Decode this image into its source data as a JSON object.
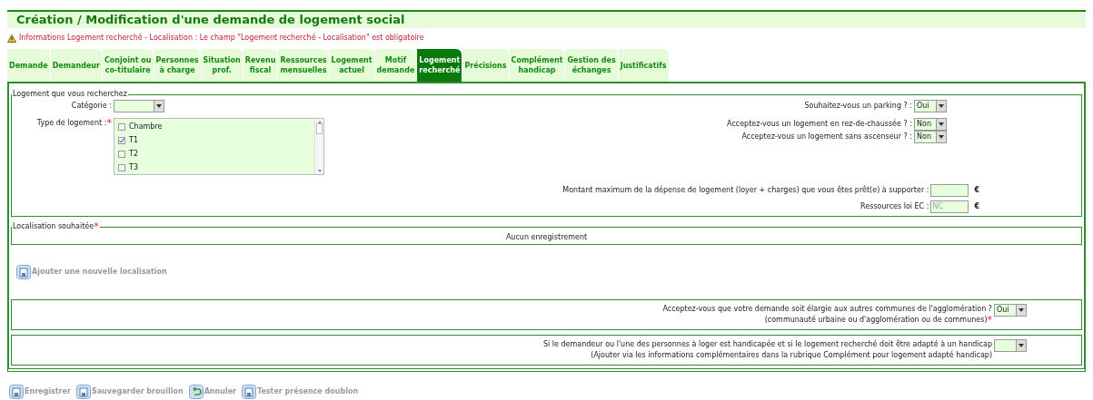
{
  "title": "Création / Modification d'une demande de logement social",
  "warning": "Informations Logement recherché - Localisation : Le champ \"Logement recherché - Localisation\" est obligatoire",
  "tabs": [
    {
      "lines": [
        "Demande"
      ],
      "selected": false
    },
    {
      "lines": [
        "Demandeur"
      ],
      "selected": false
    },
    {
      "lines": [
        "Conjoint ou",
        "co-titulaire"
      ],
      "selected": false
    },
    {
      "lines": [
        "Personnes",
        "à charge"
      ],
      "selected": false
    },
    {
      "lines": [
        "Situation",
        "prof."
      ],
      "selected": false
    },
    {
      "lines": [
        "Revenu",
        "fiscal"
      ],
      "selected": false
    },
    {
      "lines": [
        "Ressources",
        "mensuelles"
      ],
      "selected": false
    },
    {
      "lines": [
        "Logement",
        "actuel"
      ],
      "selected": false
    },
    {
      "lines": [
        "Motif",
        "demande"
      ],
      "selected": false
    },
    {
      "lines": [
        "Logement",
        "recherché"
      ],
      "selected": true
    },
    {
      "lines": [
        "Précisions"
      ],
      "selected": false
    },
    {
      "lines": [
        "Complément",
        "handicap"
      ],
      "selected": false
    },
    {
      "lines": [
        "Gestion des",
        "échanges"
      ],
      "selected": false
    },
    {
      "lines": [
        "Justificatifs"
      ],
      "selected": false
    }
  ],
  "logement": {
    "legend": "Logement que vous recherchez",
    "categorie": {
      "label": "Catégorie :"
    },
    "type": {
      "label": "Type de logement :",
      "required_mark": "*",
      "options": [
        {
          "label": "Chambre",
          "checked": false
        },
        {
          "label": "T1",
          "checked": true
        },
        {
          "label": "T2",
          "checked": false
        },
        {
          "label": "T3",
          "checked": false
        }
      ]
    },
    "questions": [
      {
        "label": "Souhaitez-vous un parking ? :",
        "value": "Oui"
      },
      {
        "label": "Acceptez-vous un logement en rez-de-chaussée ? :",
        "value": "Non"
      },
      {
        "label": "Acceptez-vous un logement sans ascenseur ? :",
        "value": "Non"
      }
    ],
    "montant": {
      "label": "Montant maximum de la dépense de logement (loyer + charges) que vous êtes prêt(e) à supporter :",
      "unit": "€"
    },
    "ressources": {
      "label": "Ressources loi EC :",
      "placeholder": "NC",
      "unit": "€"
    }
  },
  "localisation": {
    "legend": "Localisation souhaitée",
    "required_mark": "*",
    "empty": "Aucun enregistrement",
    "add": "Ajouter une nouvelle localisation"
  },
  "elargie": {
    "line1": "Acceptez-vous que votre demande soit élargie aux autres communes de l'agglomération ?",
    "line2": "(communauté urbaine ou d'agglomération ou de communes)",
    "required_mark": "*",
    "value": "Oui"
  },
  "handicap": {
    "line1": "Si le demandeur ou l'une des personnes à loger est handicapée et si le logement recherché doit être adapté à un handicap",
    "line2": "(Ajouter via les informations complémentaires dans la rubrique Complément pour logement adapté handicap)"
  },
  "actions": [
    {
      "label": "Enregistrer",
      "kind": "save"
    },
    {
      "label": "Sauvegarder brouillon",
      "kind": "save"
    },
    {
      "label": "Annuler",
      "kind": "undo"
    },
    {
      "label": "Tester présence doublon",
      "kind": "save"
    }
  ]
}
